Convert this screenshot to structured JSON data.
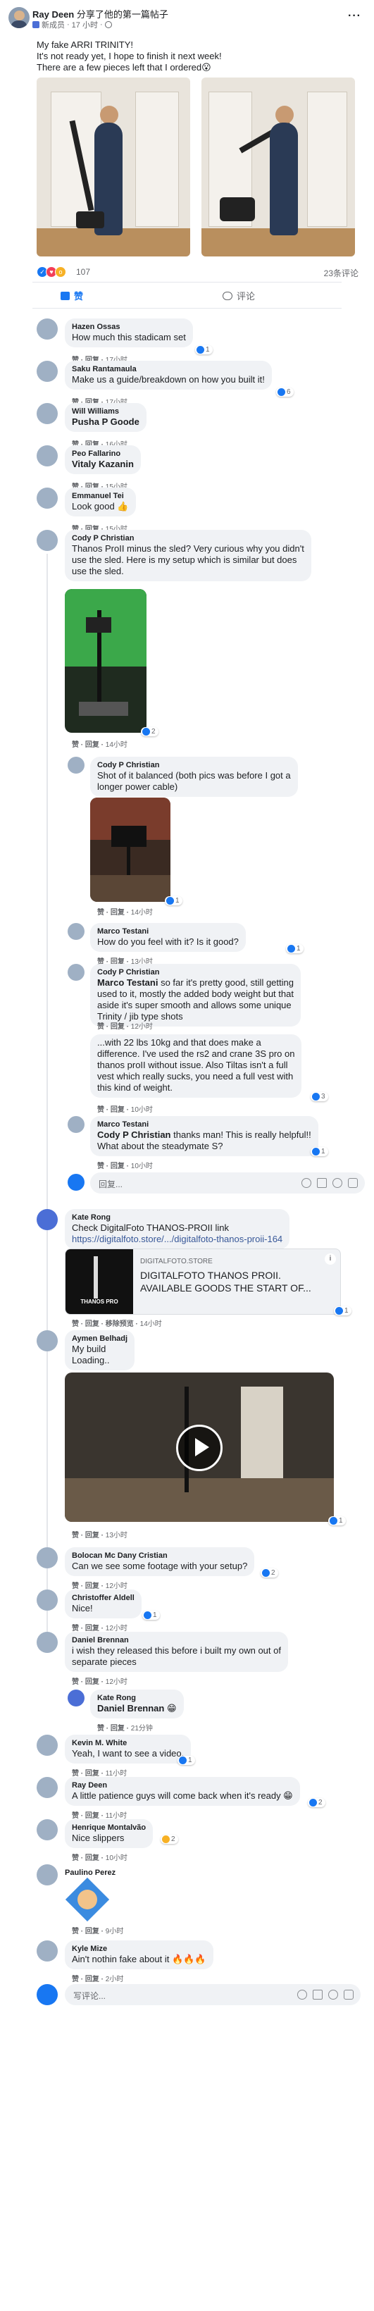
{
  "post": {
    "author": "Ray Deen",
    "action": "分享了他的第一篇帖子",
    "badge_label": "新成员",
    "time": "17 小时",
    "text_lines": [
      "My fake ARRI TRINITY!",
      "It's not ready yet, I hope to finish it next week!",
      "There are a few pieces left that I ordered😮"
    ],
    "reaction_count": "107",
    "comment_count": "23条评论",
    "like_label": "赞",
    "comment_label": "评论"
  },
  "comments": [
    {
      "name": "Hazen Ossas",
      "text": "How much this stadicam set",
      "meta_action": "赞 · 回复 · ",
      "time": "17小时",
      "likes": "1"
    },
    {
      "name": "Saku Rantamaula",
      "text": "Make us a guide/breakdown on how you built it!",
      "meta_action": "赞 · 回复 · ",
      "time": "17小时",
      "likes": "6"
    },
    {
      "name": "Will Williams",
      "text": "Pusha P Goode",
      "meta_action": "赞 · 回复 · ",
      "time": "16小时"
    },
    {
      "name": "Peo Fallarino",
      "text": "Vitaly Kazanin",
      "meta_action": "赞 · 回复 · ",
      "time": "15小时"
    },
    {
      "name": "Emmanuel Tei",
      "text": "Look good 👍",
      "meta_action": "赞 · 回复 · ",
      "time": "15小时"
    },
    {
      "name": "Cody P Christian",
      "text_lines": [
        "Thanos ProII minus the sled? Very curious why you didn't",
        "use the sled. Here is my setup which is similar but does",
        "use the sled."
      ],
      "meta_action": "赞 · 回复 · ",
      "time": "14小时",
      "likes": "2"
    },
    {
      "name": "Cody P Christian",
      "text_lines": [
        "Shot of it balanced (both pics was before I got a",
        "longer power cable)"
      ],
      "meta_action": "赞 · 回复 · ",
      "time": "14小时",
      "likes": "1"
    },
    {
      "name": "Marco Testani",
      "text_lines": [
        "How do you feel with it? Is it good?"
      ],
      "meta_action": "赞 · 回复 · ",
      "time": "13小时",
      "likes": "1"
    },
    {
      "name": "Cody P Christian",
      "mention": "Marco Testani",
      "text_lines": [
        " so far it's pretty good, still getting",
        "used to it, mostly the added body weight but that",
        "aside it's super smooth and allows some unique",
        "Trinity / jib type shots"
      ],
      "meta_action": "赞 · 回复 · ",
      "time": "12小时"
    },
    {
      "text_lines": [
        "...with 22 lbs 10kg and that does make a",
        "difference. I've used the rs2 and crane 3S pro on",
        "thanos proII without issue. Also Tiltas isn't a full",
        "vest which really sucks, you need a full vest with",
        "this kind of weight."
      ],
      "meta_action": "赞 · 回复 · ",
      "time": "10小时",
      "likes": "3"
    },
    {
      "name": "Marco Testani",
      "mention": "Cody P Christian",
      "text_lines": [
        " thanks man! This is really helpful!!",
        "What about the steadymate S?"
      ],
      "meta_action": "赞 · 回复 · ",
      "time": "10小时",
      "likes": "1"
    },
    {
      "name": "Kate Rong",
      "text_lines": [
        "Check DigitalFoto THANOS-PROII link"
      ],
      "link": "https://digitalfoto.store/.../digitalfoto-thanos-proii-164",
      "card_domain": "DIGITALFOTO.STORE",
      "card_title_lines": [
        "DIGITALFOTO THANOS PROII.",
        "AVAILABLE GOODS THE START OF..."
      ],
      "card_brand": "THANOS PRO",
      "meta_action": "赞 · 回复 · 移除预览 · ",
      "time": "14小时",
      "likes": "1"
    },
    {
      "name": "Aymen Belhadj",
      "text_lines": [
        "My build",
        "Loading.."
      ],
      "meta_action": "赞 · 回复 · ",
      "time": "13小时",
      "likes": "1"
    },
    {
      "name": "Bolocan Mc Dany Cristian",
      "text": "Can we see some footage with your setup?",
      "meta_action": "赞 · 回复 · ",
      "time": "12小时",
      "likes": "2"
    },
    {
      "name": "Christoffer Aldell",
      "text": "Nice!",
      "meta_action": "赞 · 回复 · ",
      "time": "12小时",
      "likes": "1"
    },
    {
      "name": "Daniel Brennan",
      "text_lines": [
        "i wish they released this before i built my own out of",
        "separate pieces"
      ],
      "meta_action": "赞 · 回复 · ",
      "time": "12小时"
    },
    {
      "name": "Kate Rong",
      "text": "Daniel Brennan 😁",
      "meta_action": "赞 · 回复 · ",
      "time": "21分钟"
    },
    {
      "name": "Kevin M. White",
      "text": "Yeah, I want to see a video.",
      "meta_action": "赞 · 回复 · ",
      "time": "11小时",
      "likes": "1"
    },
    {
      "name": "Ray Deen",
      "text": "A little patience guys will come back when it's ready 😁",
      "meta_action": "赞 · 回复 · ",
      "time": "11小时",
      "likes": "2"
    },
    {
      "name": "Henrique Montalvão",
      "text": "Nice slippers",
      "meta_action": "赞 · 回复 · ",
      "time": "10小时",
      "likes": "2"
    },
    {
      "name": "Paulino Perez",
      "meta_action": "赞 · 回复 · ",
      "time": "9小时"
    },
    {
      "name": "Kyle Mize",
      "text": "Ain't nothin fake about it 🔥🔥🔥",
      "meta_action": "赞 · 回复 · ",
      "time": "2小时"
    }
  ],
  "reply_placeholder": "回复...",
  "comment_placeholder": "写评论...",
  "colors": {
    "accent": "#1877f2",
    "bubble": "#f0f2f5",
    "meta": "#65676b"
  }
}
